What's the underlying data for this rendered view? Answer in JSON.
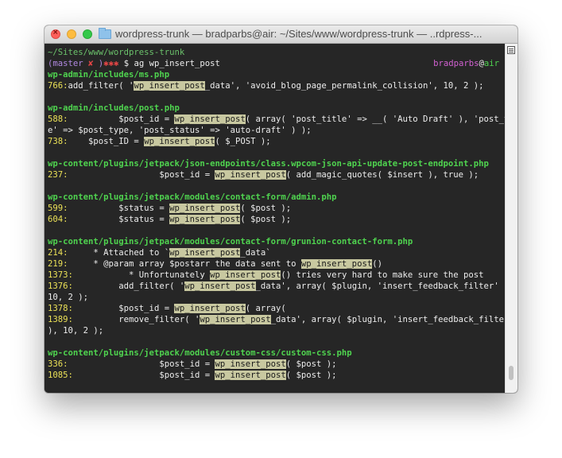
{
  "window": {
    "title": "wordpress-trunk — bradparbs@air: ~/Sites/www/wordpress-trunk — ..rdpress-..."
  },
  "terminal": {
    "cwd": "~/Sites/www/wordpress-trunk",
    "prompt": {
      "branch_open": "(master ",
      "dirty": "✘",
      "branch_close": " )",
      "stars": "✱✱✱",
      "symbol": " $ ",
      "command": "ag wp_insert_post",
      "user": "bradparbs",
      "at": "@",
      "host": "air"
    },
    "highlight_term": "wp_insert_post",
    "lines": [
      {
        "t": "file",
        "text": "wp-admin/includes/ms.php"
      },
      {
        "t": "code",
        "num": "766:",
        "pre": "add_filter( '",
        "hl": "wp_insert_post",
        "post": "_data', 'avoid_blog_page_permalink_collision', 10, 2 );"
      },
      {
        "t": "blank"
      },
      {
        "t": "file",
        "text": "wp-admin/includes/post.php"
      },
      {
        "t": "code",
        "num": "588:",
        "pre": "          $post_id = ",
        "hl": "wp_insert_post",
        "post": "( array( 'post_title' => __( 'Auto Draft' ), 'post_typ"
      },
      {
        "t": "plain",
        "text": "e' => $post_type, 'post_status' => 'auto-draft' ) );"
      },
      {
        "t": "code",
        "num": "738:",
        "pre": "    $post_ID = ",
        "hl": "wp_insert_post",
        "post": "( $_POST );"
      },
      {
        "t": "blank"
      },
      {
        "t": "file",
        "text": "wp-content/plugins/jetpack/json-endpoints/class.wpcom-json-api-update-post-endpoint.php"
      },
      {
        "t": "code",
        "num": "237:",
        "pre": "                  $post_id = ",
        "hl": "wp_insert_post",
        "post": "( add_magic_quotes( $insert ), true );"
      },
      {
        "t": "blank"
      },
      {
        "t": "file",
        "text": "wp-content/plugins/jetpack/modules/contact-form/admin.php"
      },
      {
        "t": "code",
        "num": "599:",
        "pre": "          $status = ",
        "hl": "wp_insert_post",
        "post": "( $post );"
      },
      {
        "t": "code",
        "num": "604:",
        "pre": "          $status = ",
        "hl": "wp_insert_post",
        "post": "( $post );"
      },
      {
        "t": "blank"
      },
      {
        "t": "file",
        "text": "wp-content/plugins/jetpack/modules/contact-form/grunion-contact-form.php"
      },
      {
        "t": "code",
        "num": "214:",
        "pre": "     * Attached to `",
        "hl": "wp_insert_post",
        "post": "_data`"
      },
      {
        "t": "code",
        "num": "219:",
        "pre": "     * @param array $postarr the data sent to ",
        "hl": "wp_insert_post",
        "post": "()"
      },
      {
        "t": "code",
        "num": "1373:",
        "pre": "           * Unfortunately ",
        "hl": "wp_insert_post",
        "post": "() tries very hard to make sure the post"
      },
      {
        "t": "code",
        "num": "1376:",
        "pre": "         add_filter( '",
        "hl": "wp_insert_post",
        "post": "_data', array( $plugin, 'insert_feedback_filter' ),"
      },
      {
        "t": "plain",
        "text": "10, 2 );"
      },
      {
        "t": "code",
        "num": "1378:",
        "pre": "         $post_id = ",
        "hl": "wp_insert_post",
        "post": "( array("
      },
      {
        "t": "code",
        "num": "1389:",
        "pre": "         remove_filter( '",
        "hl": "wp_insert_post",
        "post": "_data', array( $plugin, 'insert_feedback_filter'"
      },
      {
        "t": "plain",
        "text": "), 10, 2 );"
      },
      {
        "t": "blank"
      },
      {
        "t": "file",
        "text": "wp-content/plugins/jetpack/modules/custom-css/custom-css.php"
      },
      {
        "t": "code",
        "num": "336:",
        "pre": "                  $post_id = ",
        "hl": "wp_insert_post",
        "post": "( $post );"
      },
      {
        "t": "code",
        "num": "1085:",
        "pre": "                 $post_id = ",
        "hl": "wp_insert_post",
        "post": "( $post );"
      }
    ]
  },
  "colors": {
    "background": "#262626",
    "text": "#ededed",
    "path": "#6bc26b",
    "filename": "#4fd34f",
    "line_number": "#ebe157",
    "match_highlight": "#c8c8a0"
  }
}
